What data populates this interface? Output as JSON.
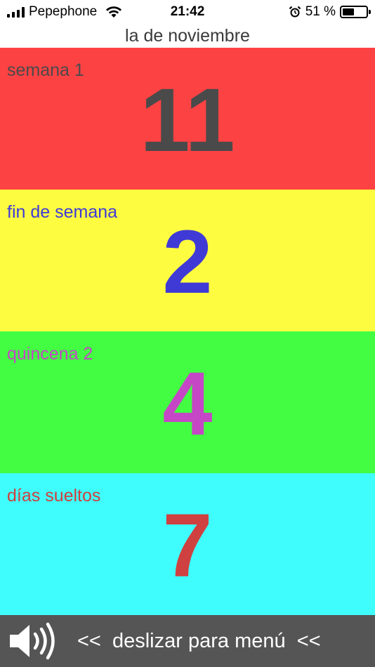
{
  "status_bar": {
    "carrier": "Pepephone",
    "time": "21:42",
    "battery_text": "51 %",
    "battery_level": 0.51,
    "icons": [
      "signal-icon",
      "wifi-icon",
      "alarm-icon",
      "battery-icon"
    ]
  },
  "header": {
    "title": "la de noviembre"
  },
  "panels": [
    {
      "label": "semana 1",
      "count": "11",
      "bg": "#fd4244",
      "label_color": "#4a4a4a",
      "count_color": "#4a4a4a"
    },
    {
      "label": "fin de semana",
      "count": "2",
      "bg": "#fdfc41",
      "label_color": "#3f3ad6",
      "count_color": "#3f3ad6"
    },
    {
      "label": "quincena 2",
      "count": "4",
      "bg": "#42fd42",
      "label_color": "#c547c6",
      "count_color": "#c547c6"
    },
    {
      "label": "días sueltos",
      "count": "7",
      "bg": "#3ffcfd",
      "label_color": "#cf4040",
      "count_color": "#cf4040"
    }
  ],
  "bottom_bar": {
    "bg": "#555555",
    "speaker_icon": "speaker-icon",
    "hint": "<<  deslizar para menú  <<"
  }
}
